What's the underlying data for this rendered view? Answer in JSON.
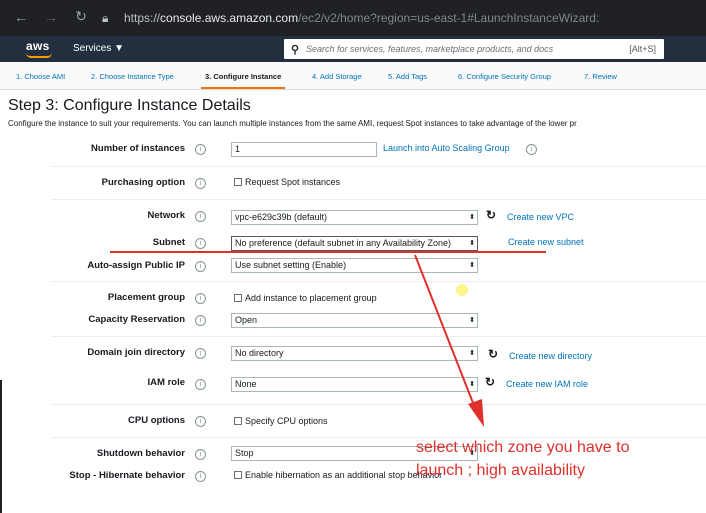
{
  "browser": {
    "url_prefix": "https://",
    "url_host": "console.aws.amazon.com",
    "url_path": "/ec2/v2/home?region=us-east-1#LaunchInstanceWizard:"
  },
  "header": {
    "logo": "aws",
    "services_label": "Services ▼",
    "search_placeholder": "Search for services, features, marketplace products, and docs",
    "search_shortcut": "[Alt+S]"
  },
  "wizard": {
    "tabs": [
      {
        "label": "1. Choose AMI"
      },
      {
        "label": "2. Choose Instance Type"
      },
      {
        "label": "3. Configure Instance"
      },
      {
        "label": "4. Add Storage"
      },
      {
        "label": "5. Add Tags"
      },
      {
        "label": "6. Configure Security Group"
      },
      {
        "label": "7. Review"
      }
    ],
    "active_tab": 2
  },
  "page": {
    "title": "Step 3: Configure Instance Details",
    "description": "Configure the instance to suit your requirements. You can launch multiple instances from the same AMI, request Spot instances to take advantage of the lower pr"
  },
  "form": {
    "number_of_instances": {
      "label": "Number of instances",
      "value": "1",
      "link": "Launch into Auto Scaling Group"
    },
    "purchasing_option": {
      "label": "Purchasing option",
      "checkbox": "Request Spot instances"
    },
    "network": {
      "label": "Network",
      "value": "vpc-e629c39b (default)",
      "link": "Create new VPC"
    },
    "subnet": {
      "label": "Subnet",
      "value": "No preference (default subnet in any Availability Zone)",
      "link": "Create new subnet"
    },
    "auto_assign_ip": {
      "label": "Auto-assign Public IP",
      "value": "Use subnet setting (Enable)"
    },
    "placement_group": {
      "label": "Placement group",
      "checkbox": "Add instance to placement group"
    },
    "capacity_reservation": {
      "label": "Capacity Reservation",
      "value": "Open"
    },
    "domain_join": {
      "label": "Domain join directory",
      "value": "No directory",
      "link": "Create new directory"
    },
    "iam_role": {
      "label": "IAM role",
      "value": "None",
      "link": "Create new IAM role"
    },
    "cpu_options": {
      "label": "CPU options",
      "checkbox": "Specify CPU options"
    },
    "shutdown_behavior": {
      "label": "Shutdown behavior",
      "value": "Stop"
    },
    "stop_hibernate": {
      "label": "Stop - Hibernate behavior",
      "checkbox": "Enable hibernation as an additional stop behavior"
    }
  },
  "annotation": {
    "line1": "select which zone you have to",
    "line2": "launch ; high availability",
    "color": "#e0302a"
  },
  "colors": {
    "link": "#0073bb",
    "accent": "#ec7211",
    "header_bg": "#232f3e"
  }
}
